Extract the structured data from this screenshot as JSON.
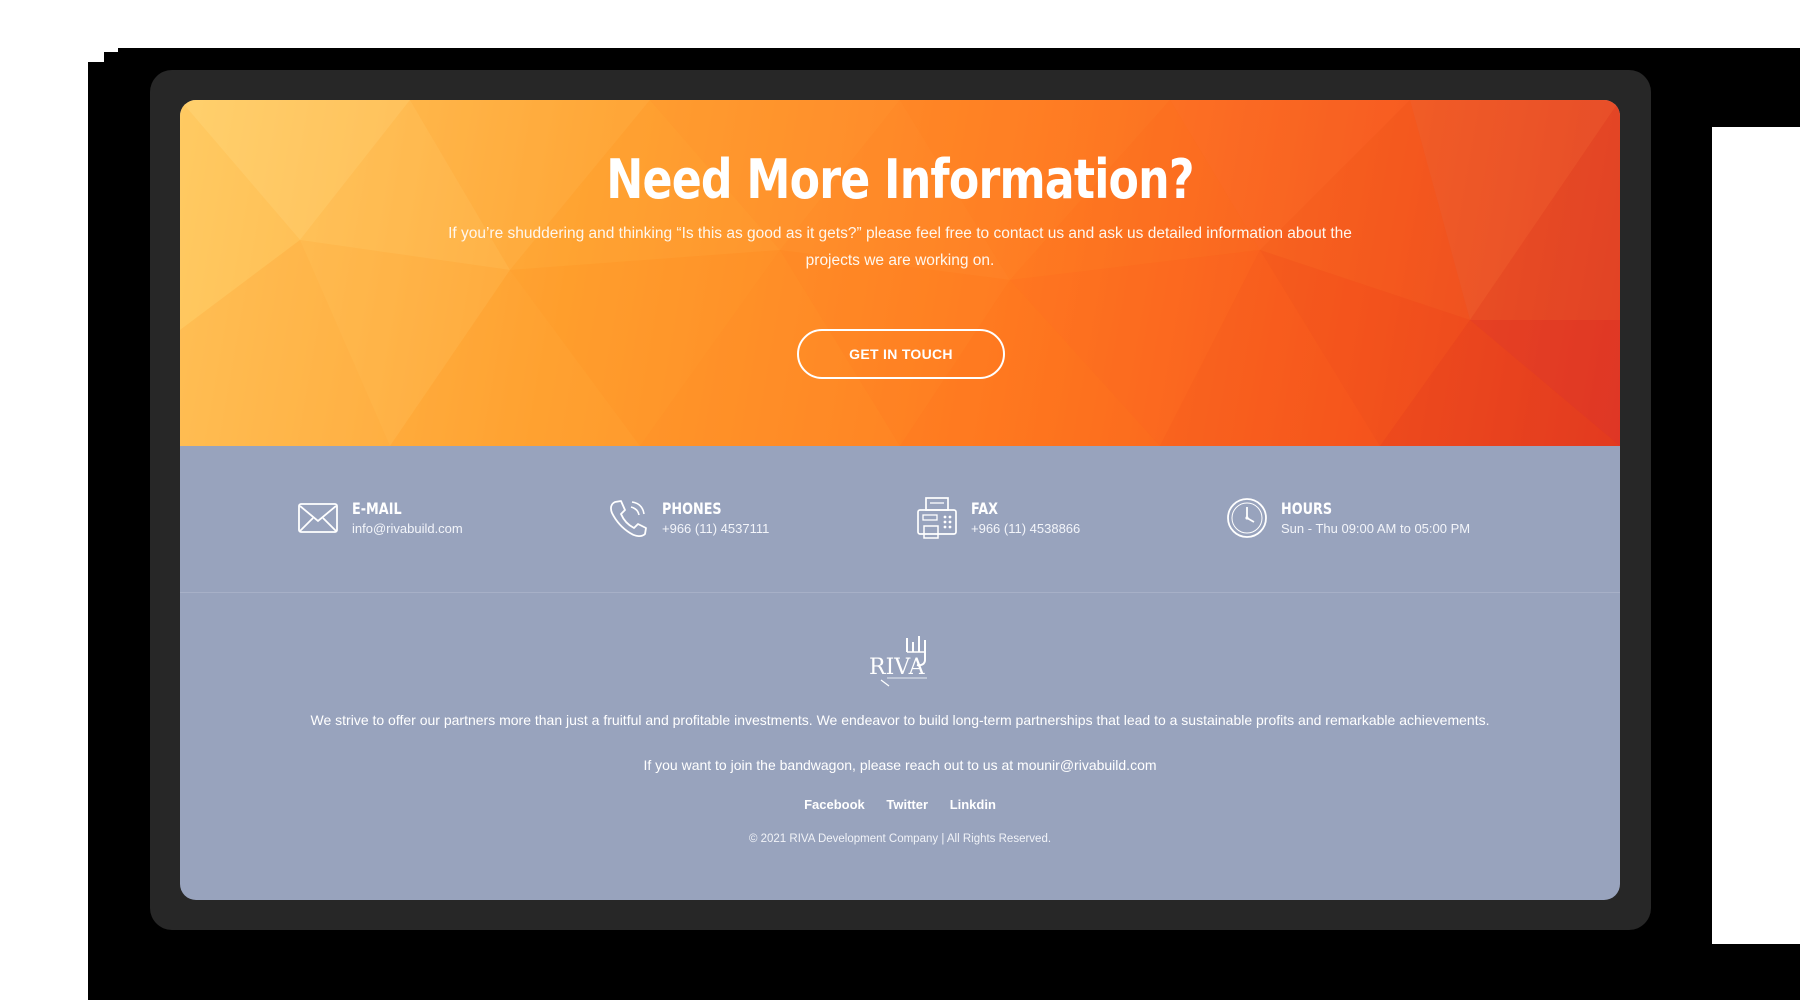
{
  "hero": {
    "title": "Need More Information?",
    "text": "If you’re shuddering and thinking “Is this as good as it gets?” please feel free to contact us and ask us detailed information about the projects we are working on.",
    "cta_label": "GET IN TOUCH"
  },
  "contact": [
    {
      "title": "E-MAIL",
      "value": "info@rivabuild.com",
      "icon": "envelope-icon"
    },
    {
      "title": "PHONES",
      "value": "+966 (11) 4537111",
      "icon": "phone-icon"
    },
    {
      "title": "FAX",
      "value": "+966 (11) 4538866",
      "icon": "fax-icon"
    },
    {
      "title": "HOURS",
      "value": "Sun - Thu 09:00 AM to 05:00 PM",
      "icon": "clock-icon"
    }
  ],
  "footer": {
    "logo_text": "RIVA",
    "about": "We strive to offer our partners more than just a fruitful and profitable investments. We endeavor to build long-term partnerships that lead to a sustainable profits and remarkable achievements.",
    "reach": "If you want to join the bandwagon, please reach out to us at mounir@rivabuild.com",
    "social": [
      "Facebook",
      "Twitter",
      "Linkdin"
    ],
    "copyright": "© 2021 RIVA Development Company | All Rights Reserved."
  },
  "colors": {
    "device_frame": "#272727",
    "footer_bg": "#98a3bd",
    "hero_start": "#ffc85e",
    "hero_end": "#e33a22"
  }
}
